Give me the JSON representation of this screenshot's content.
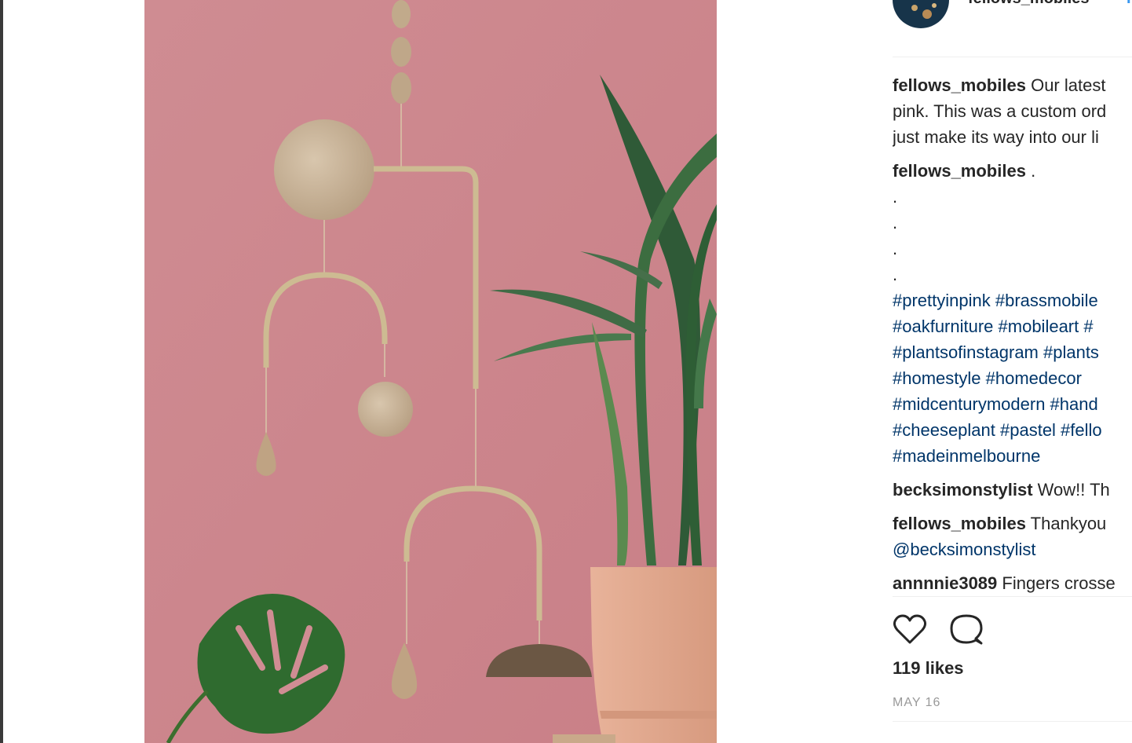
{
  "post": {
    "account": "fellows_mobiles",
    "separator": "•",
    "follow_label": "F",
    "caption": {
      "username": "fellows_mobiles",
      "lines": [
        "Our latest",
        "pink. This was a custom ord",
        "just make its way into our li"
      ]
    },
    "second_comment": {
      "username": "fellows_mobiles",
      "text": ".",
      "dots": [
        ".",
        ".",
        ".",
        "."
      ],
      "hashtags": [
        "#prettyinpink #brassmobile",
        "#oakfurniture #mobileart #",
        "#plantsofinstagram #plants",
        "#homestyle #homedecor",
        "#midcenturymodern #hand",
        "#cheeseplant #pastel #fello",
        "#madeinmelbourne"
      ]
    },
    "comments": [
      {
        "username": "becksimonstylist",
        "text": "Wow!! Th"
      },
      {
        "username": "fellows_mobiles",
        "text": "Thankyou",
        "mention": "@becksimonstylist"
      },
      {
        "username": "annnnie3089",
        "text": "Fingers crosse"
      }
    ],
    "likes": "119 likes",
    "date": "MAY 16",
    "icons": {
      "like": "heart-icon",
      "comment": "comment-icon"
    },
    "colors": {
      "hashtag": "#003569",
      "wall": "#d08d93",
      "brass": "#c9b58a",
      "pot": "#e3a98d"
    }
  }
}
